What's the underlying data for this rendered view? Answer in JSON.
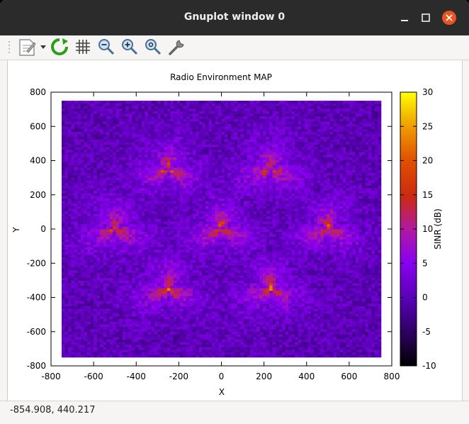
{
  "window": {
    "title": "Gnuplot window 0"
  },
  "toolbar": {
    "buttons": [
      {
        "name": "export-icon"
      },
      {
        "name": "replot-icon"
      },
      {
        "name": "grid-icon"
      },
      {
        "name": "zoom-out-icon"
      },
      {
        "name": "zoom-in-icon"
      },
      {
        "name": "zoom-auto-icon"
      },
      {
        "name": "settings-wrench-icon"
      }
    ]
  },
  "status": {
    "coords": "-854.908,  440.217"
  },
  "chart_data": {
    "type": "heatmap",
    "title": "Radio Environment MAP",
    "xlabel": "X",
    "ylabel": "Y",
    "xlim": [
      -800,
      800
    ],
    "ylim": [
      -800,
      800
    ],
    "xticks": [
      "-800",
      "-600",
      "-400",
      "-200",
      "0",
      "200",
      "400",
      "600",
      "800"
    ],
    "yticks": [
      "800",
      "600",
      "400",
      "200",
      "0",
      "-200",
      "-400",
      "-600",
      "-800"
    ],
    "colorbar": {
      "label": "SINR (dB)",
      "range": [
        -10,
        30
      ],
      "ticks": [
        "30",
        "25",
        "20",
        "15",
        "10",
        "5",
        "0",
        "-5",
        "-10"
      ]
    },
    "data_extent": {
      "x": [
        -750,
        750
      ],
      "y": [
        -750,
        750
      ]
    },
    "background_sinr_db": 0,
    "base_stations": [
      {
        "x": -250,
        "y": 350
      },
      {
        "x": 230,
        "y": 350
      },
      {
        "x": -500,
        "y": 0
      },
      {
        "x": 0,
        "y": 0
      },
      {
        "x": 500,
        "y": 0
      },
      {
        "x": -250,
        "y": -350
      },
      {
        "x": 230,
        "y": -350
      }
    ],
    "peak_sinr_db": 26
  }
}
